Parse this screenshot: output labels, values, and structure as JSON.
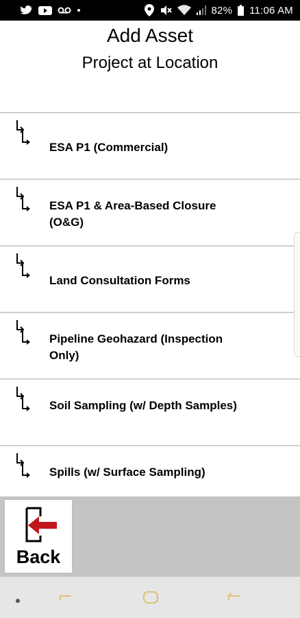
{
  "status_bar": {
    "battery": "82%",
    "time": "11:06 AM",
    "left_icons": [
      "twitter-icon",
      "youtube-icon",
      "voicemail-icon",
      "dot-icon"
    ],
    "right_icons": [
      "location-icon",
      "mute-icon",
      "wifi-icon",
      "signal-icon",
      "battery-icon"
    ]
  },
  "header": {
    "title": "Add Asset",
    "subtitle": "Project at Location"
  },
  "assets": [
    {
      "label": "ESA P1 (Commercial)",
      "icon": "branch-arrow-icon"
    },
    {
      "label": "ESA P1 & Area-Based Closure (O&G)",
      "icon": "branch-arrow-icon"
    },
    {
      "label": "Land Consultation Forms",
      "icon": "branch-arrow-icon"
    },
    {
      "label": "Pipeline Geohazard (Inspection Only)",
      "icon": "branch-arrow-icon"
    },
    {
      "label": "Soil Sampling (w/ Depth Samples)",
      "icon": "branch-arrow-icon"
    },
    {
      "label": "Spills (w/ Surface Sampling)",
      "icon": "branch-arrow-icon"
    }
  ],
  "action_bar": {
    "back_label": "Back",
    "back_icon": "exit-arrow-icon"
  },
  "nav_bar": {
    "icons": [
      "nav-dot-icon",
      "recents-icon",
      "home-icon",
      "back-nav-icon"
    ]
  },
  "colors": {
    "status_bar_bg": "#000000",
    "back_arrow": "#c0161c",
    "action_bar_bg": "#c4c4c4",
    "nav_bar_bg": "#e6e6e6",
    "nav_icon": "#d9c27a"
  }
}
